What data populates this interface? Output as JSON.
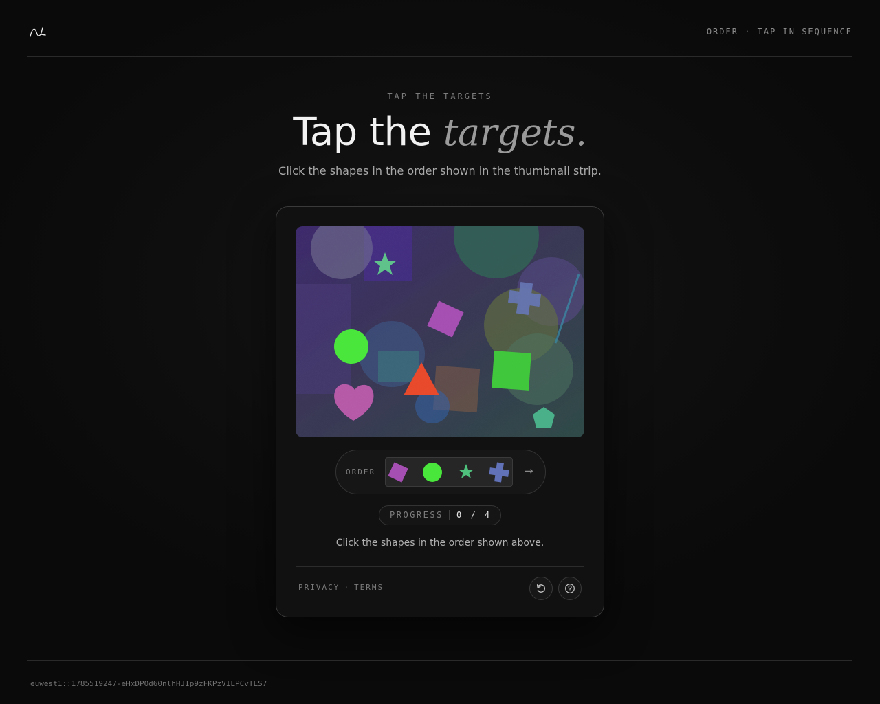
{
  "header": {
    "logo_icon": "wave-logo-icon",
    "mode_label": "ORDER · TAP IN SEQUENCE"
  },
  "hero": {
    "eyebrow": "TAP THE TARGETS",
    "title_plain": "Tap the",
    "title_emphasis": "targets.",
    "subtitle": "Click the shapes in the order shown in the thumbnail strip."
  },
  "challenge": {
    "order_label": "ORDER",
    "order_sequence": [
      "diamond",
      "circle",
      "star",
      "cross"
    ],
    "progress_label": "PROGRESS",
    "progress_value": "0 / 4",
    "progress_done": 0,
    "progress_total": 4,
    "instruction": "Click the shapes in the order shown above.",
    "colors": {
      "diamond": "#a64fb3",
      "circle": "#49e63c",
      "star": "#4fc27d",
      "cross": "#6272b8",
      "triangle": "#e84a2c",
      "square": "#3fc73c",
      "heart": "#b65aa8",
      "pentagon": "#49b08a"
    }
  },
  "legal": {
    "privacy": "PRIVACY",
    "separator": "·",
    "terms": "TERMS"
  },
  "actions": {
    "refresh_icon": "refresh-icon",
    "help_icon": "help-icon"
  },
  "footer": {
    "session_id": "euwest1::1785519247-eHxDPOd60nlhHJIp9zFKPzVILPCvTLS7"
  }
}
